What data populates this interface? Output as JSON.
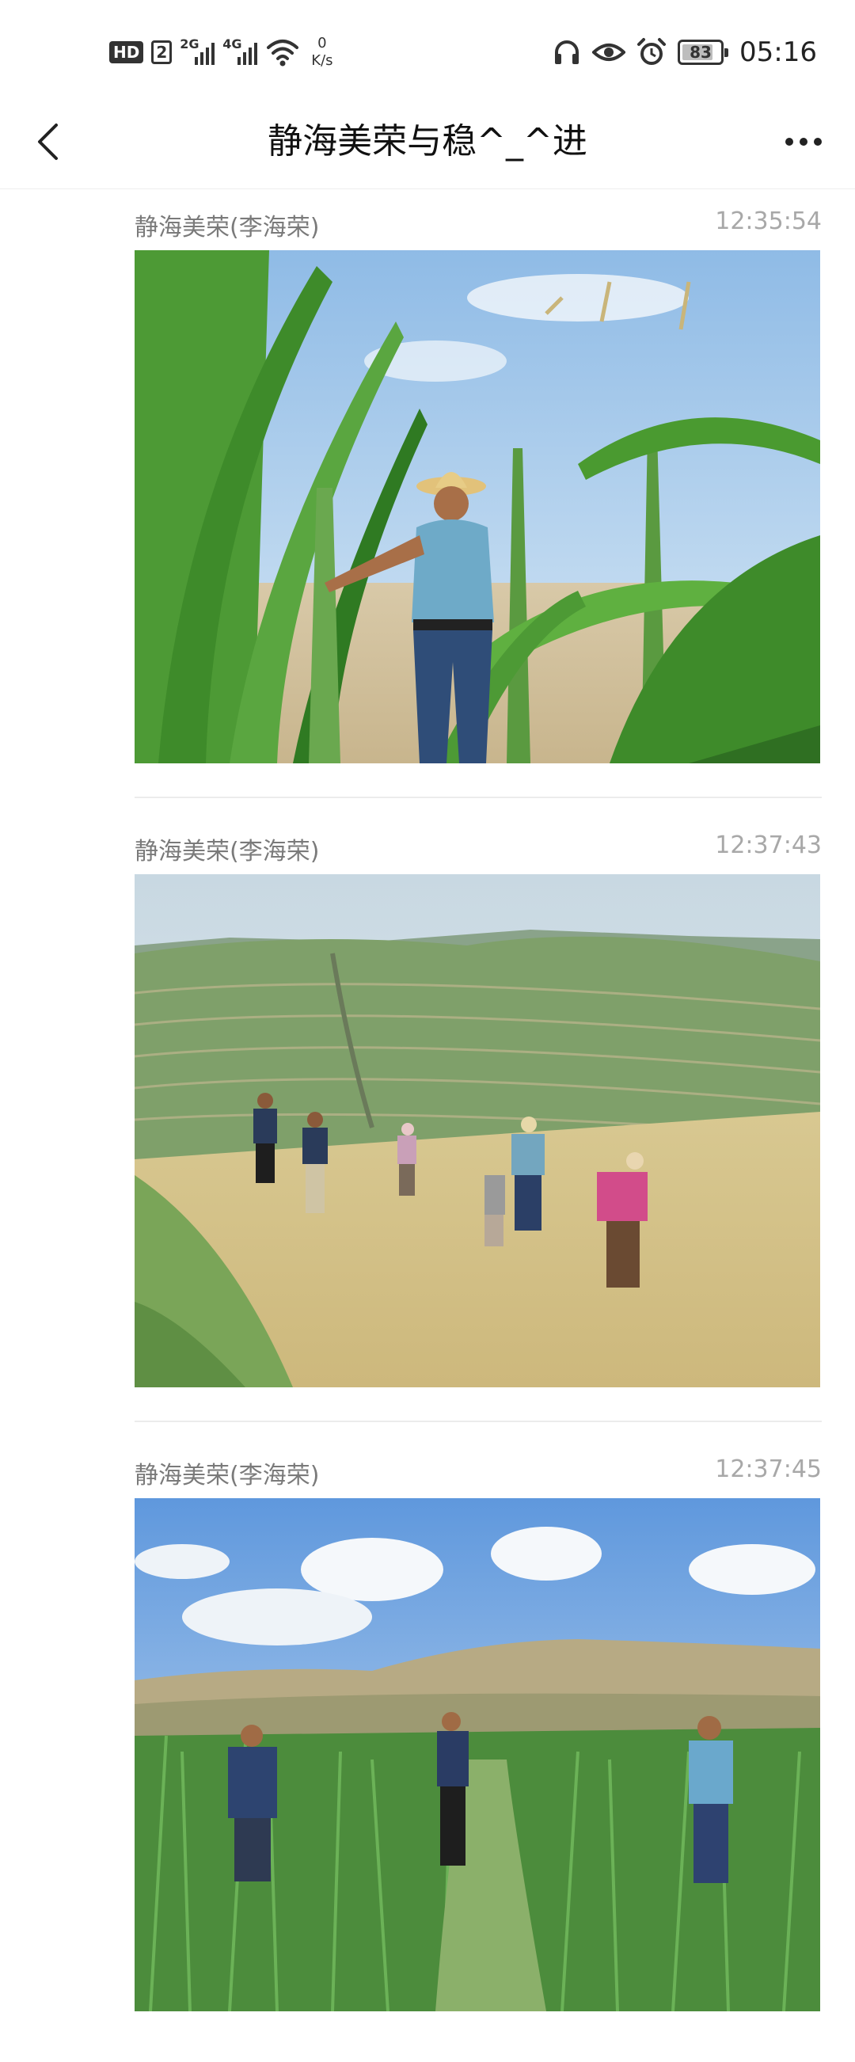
{
  "status_bar": {
    "hd_badge": "HD",
    "sim_slot": "2",
    "signal_1_tag": "2G",
    "signal_2_tag": "4G",
    "net_speed_value": "0",
    "net_speed_unit": "K/s",
    "battery_level": "83",
    "clock": "05:16",
    "icons": [
      "headphones-icon",
      "eye-icon",
      "alarm-icon",
      "wifi-icon",
      "battery-icon"
    ]
  },
  "header": {
    "title": "静海美荣与稳^_^进",
    "back_icon": "chevron-left-icon",
    "more_icon": "more-dots-icon"
  },
  "feed": {
    "items": [
      {
        "author": "静海美荣(李海荣)",
        "time": "12:35:54"
      },
      {
        "author": "静海美荣(李海荣)",
        "time": "12:37:43"
      },
      {
        "author": "静海美荣(李海荣)",
        "time": "12:37:45"
      }
    ]
  }
}
